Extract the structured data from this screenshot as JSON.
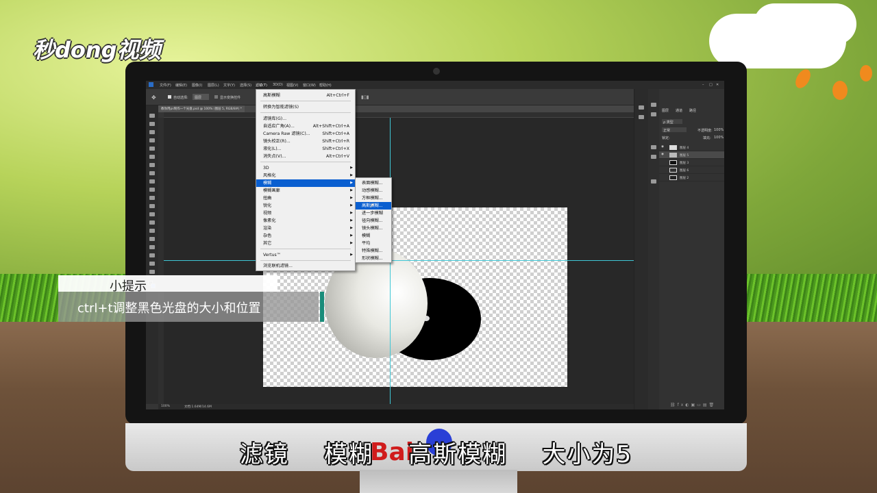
{
  "watermark": {
    "logo_text": "秒dong视频",
    "baidu_text": "Bai"
  },
  "ps": {
    "menu_bar": [
      "文件(F)",
      "编辑(E)",
      "图像(I)",
      "图层(L)",
      "文字(Y)",
      "选择(S)",
      "滤镜(T)",
      "3D(D)",
      "视图(V)",
      "窗口(W)",
      "帮助(H)"
    ],
    "options": {
      "auto_select": "自动选择:",
      "layer_select": "图层",
      "transform_controls": "显示变换控件"
    },
    "doc_tab": "教你用ps制作一个光盘.psd @ 100% (图层 5, RGB/8#) *",
    "status": {
      "zoom": "100%",
      "doc_size": "文档:1.64M/14.6M"
    },
    "layers_panel": {
      "tabs": [
        "图层",
        "通道",
        "路径"
      ],
      "kind": "ρ 类型",
      "blend_mode": "正常",
      "opacity_label": "不透明度:",
      "opacity_value": "100%",
      "lock_label": "锁定:",
      "fill_label": "填充:",
      "fill_value": "100%",
      "layers": [
        "图层 4",
        "图层 5",
        "图层 3",
        "图层 6",
        "图层 2"
      ]
    }
  },
  "filter_menu": {
    "items": [
      {
        "label": "高斯模糊",
        "shortcut": "Alt+Ctrl+F"
      },
      {
        "label": "转换为智能滤镜(S)",
        "shortcut": ""
      },
      {
        "label": "滤镜库(G)...",
        "shortcut": ""
      },
      {
        "label": "自适应广角(A)...",
        "shortcut": "Alt+Shift+Ctrl+A"
      },
      {
        "label": "Camera Raw 滤镜(C)...",
        "shortcut": "Shift+Ctrl+A"
      },
      {
        "label": "镜头校正(R)...",
        "shortcut": "Shift+Ctrl+R"
      },
      {
        "label": "液化(L)...",
        "shortcut": "Shift+Ctrl+X"
      },
      {
        "label": "消失点(V)...",
        "shortcut": "Alt+Ctrl+V"
      },
      {
        "label": "3D",
        "shortcut": ""
      },
      {
        "label": "风格化",
        "shortcut": ""
      },
      {
        "label": "模糊",
        "shortcut": ""
      },
      {
        "label": "模糊画廊",
        "shortcut": ""
      },
      {
        "label": "扭曲",
        "shortcut": ""
      },
      {
        "label": "锐化",
        "shortcut": ""
      },
      {
        "label": "视频",
        "shortcut": ""
      },
      {
        "label": "像素化",
        "shortcut": ""
      },
      {
        "label": "渲染",
        "shortcut": ""
      },
      {
        "label": "杂色",
        "shortcut": ""
      },
      {
        "label": "其它",
        "shortcut": ""
      },
      {
        "label": "Vertus™",
        "shortcut": ""
      },
      {
        "label": "浏览联机滤镜...",
        "shortcut": ""
      }
    ]
  },
  "blur_submenu": {
    "items": [
      "表面模糊...",
      "动感模糊...",
      "方框模糊...",
      "高斯模糊...",
      "进一步模糊",
      "径向模糊...",
      "镜头模糊...",
      "模糊",
      "平均",
      "特殊模糊...",
      "形状模糊..."
    ]
  },
  "tip": {
    "title": "小提示",
    "body": "ctrl+t调整黑色光盘的大小和位置"
  },
  "subtitle": "滤镜    模糊    高斯模糊    大小为5",
  "colors": {
    "highlight": "#0a5fd0",
    "guide": "#3fc7d6",
    "accent": "#1a8c7a"
  }
}
